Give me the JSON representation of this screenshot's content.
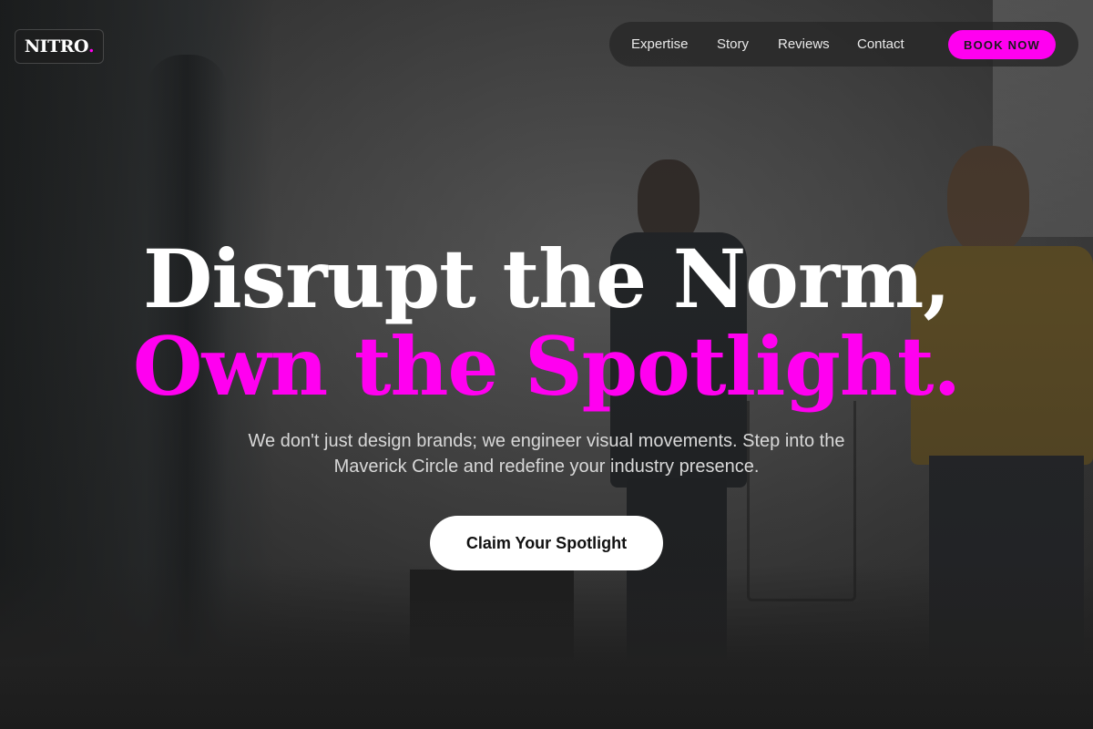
{
  "brand": {
    "name": "NITRO",
    "dot": ".",
    "accent_color": "#ff00f0"
  },
  "nav": {
    "items": [
      {
        "label": "Expertise"
      },
      {
        "label": "Story"
      },
      {
        "label": "Reviews"
      },
      {
        "label": "Contact"
      }
    ],
    "book_label": "BOOK NOW"
  },
  "hero": {
    "headline_line1": "Disrupt the Norm,",
    "headline_line2": "Own the Spotlight.",
    "subtitle": "We don't just design brands; we engineer visual movements. Step into the Maverick Circle and redefine your industry presence.",
    "cta_label": "Claim Your Spotlight",
    "background_image": "photo-studio-photoshoot-image"
  }
}
